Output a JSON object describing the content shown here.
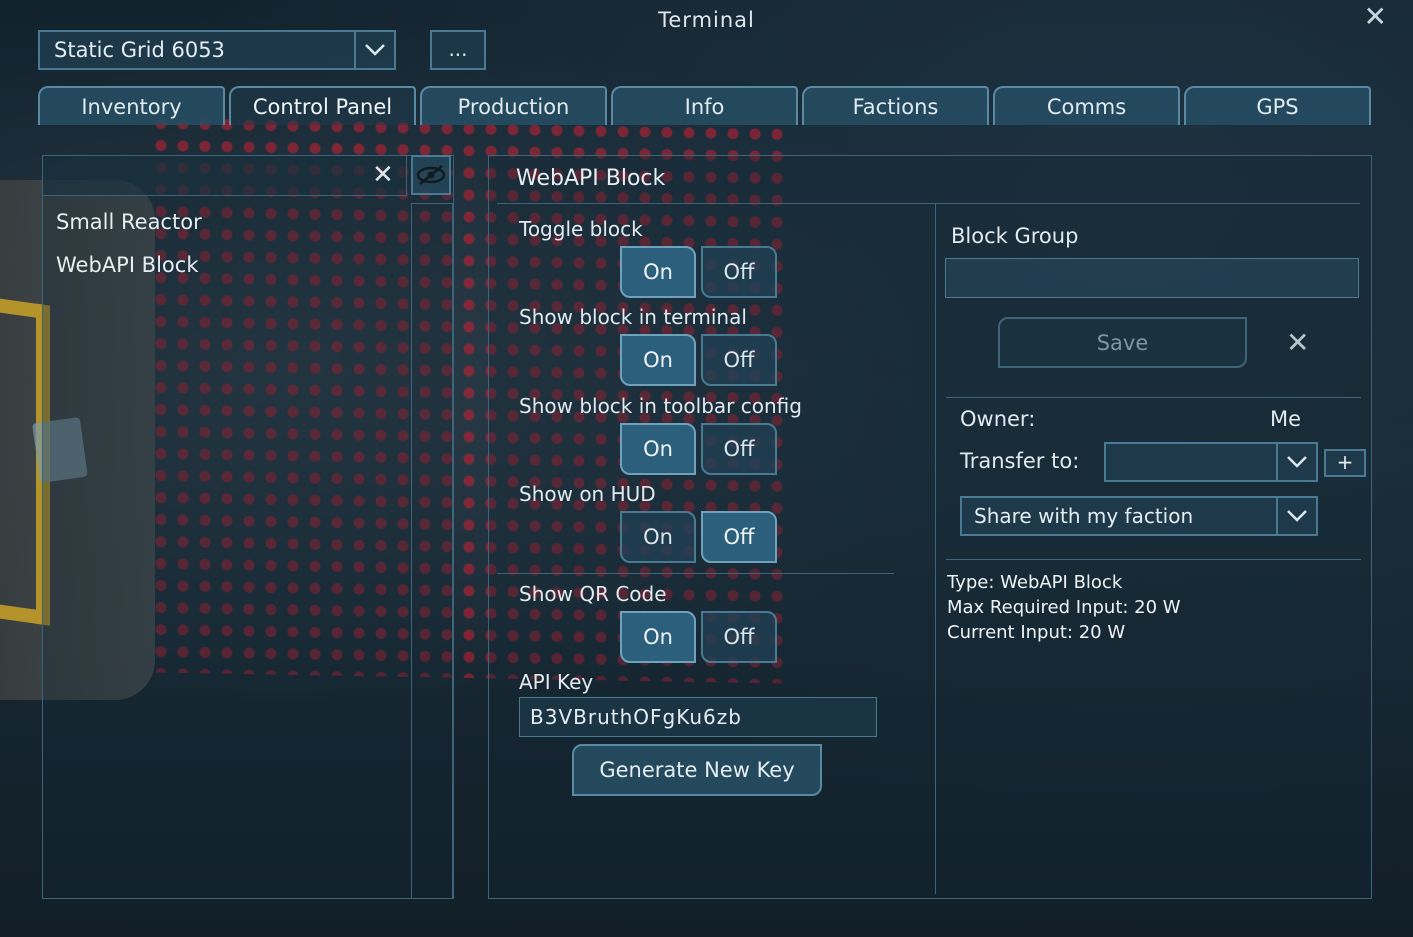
{
  "window": {
    "title": "Terminal"
  },
  "grid_selector": {
    "value": "Static Grid 6053"
  },
  "more_button": {
    "label": "..."
  },
  "tabs": [
    {
      "label": "Inventory"
    },
    {
      "label": "Control Panel",
      "active": true
    },
    {
      "label": "Production"
    },
    {
      "label": "Info"
    },
    {
      "label": "Factions"
    },
    {
      "label": "Comms"
    },
    {
      "label": "GPS"
    }
  ],
  "block_list": {
    "search_value": "",
    "items": [
      {
        "label": "Small Reactor"
      },
      {
        "label": "WebAPI Block"
      }
    ]
  },
  "block_panel": {
    "title": "WebAPI Block",
    "toggle_block": {
      "label": "Toggle block",
      "on": "On",
      "off": "Off",
      "selected": "On"
    },
    "show_in_terminal": {
      "label": "Show block in terminal",
      "on": "On",
      "off": "Off",
      "selected": "On"
    },
    "show_in_toolbar": {
      "label": "Show block in toolbar config",
      "on": "On",
      "off": "Off",
      "selected": "On"
    },
    "show_on_hud": {
      "label": "Show on HUD",
      "on": "On",
      "off": "Off",
      "selected": "Off"
    },
    "show_qr": {
      "label": "Show QR Code",
      "on": "On",
      "off": "Off",
      "selected": "On"
    },
    "api_key": {
      "label": "API Key",
      "value": "B3VBruthOFgKu6zb"
    },
    "generate_key_label": "Generate New Key"
  },
  "side_panel": {
    "block_group_label": "Block Group",
    "block_group_value": "",
    "save_label": "Save",
    "owner_label": "Owner:",
    "owner_value": "Me",
    "transfer_label": "Transfer to:",
    "transfer_value": "",
    "add_label": "+",
    "share_value": "Share with my faction",
    "info": {
      "type": "Type: WebAPI Block",
      "max_input": "Max Required Input: 20 W",
      "current_input": "Current Input: 20 W"
    }
  },
  "colors": {
    "accent": "#4a7a92",
    "selected": "#2c5f7c",
    "qr_dots": "#c81e32"
  }
}
